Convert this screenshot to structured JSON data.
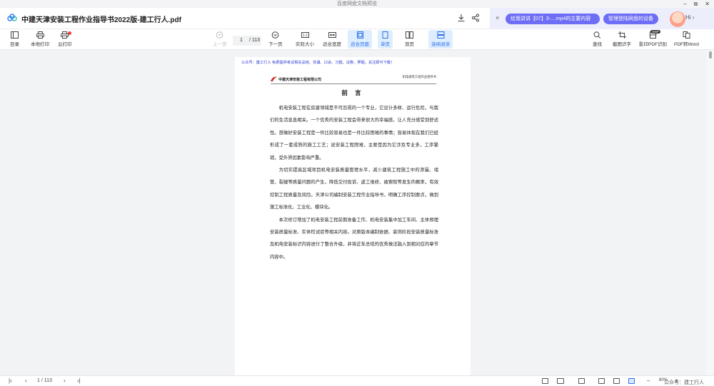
{
  "window": {
    "title": "百度网盘文档预览",
    "minimize": "–",
    "restore": "⧉",
    "close": "✕"
  },
  "header": {
    "doc_title": "中建天津安装工程作业指导书2022版-建工行人.pdf",
    "right_panel": {
      "close": "×",
      "pill_1": "给我讲讲【07】3-....mp4的主要内容",
      "pill_2": "管理登陆网盘的设备",
      "hi_label": "Hi ›"
    }
  },
  "toolbar": {
    "left": [
      {
        "label": "目录",
        "icon": "toc-icon"
      },
      {
        "label": "本地打印",
        "icon": "print-icon"
      },
      {
        "label": "云打印",
        "icon": "cloud-print-icon"
      }
    ],
    "prev_page": "上一页",
    "page_current": "1",
    "page_total": "/ 113",
    "next_page": "下一页",
    "actual_size": "实际大小",
    "fit_width": "适合宽度",
    "fit_page": "适合页面",
    "single_page": "单页",
    "double_page": "双页",
    "continuous": "连续阅读",
    "right": [
      {
        "label": "查找",
        "icon": "search-icon"
      },
      {
        "label": "截图识字",
        "icon": "screenshot-ocr-icon"
      },
      {
        "label": "影印PDF识别",
        "icon": "scan-pdf-icon"
      },
      {
        "label": "PDF转Word",
        "icon": "pdf-to-word-icon"
      }
    ],
    "new_badge": "SWP"
  },
  "document": {
    "promo_line": "公众号：建工行人  免费提供考试相关总结、背诵、口诀、习题、试卷、押题，关注即可下载！",
    "logo_text": "中建天津安装工程有限公司",
    "running_header": "机电安装工程作业指导书",
    "heading": "前 言",
    "paragraphs": [
      "机电安装工程在房建领域是不可忽视的一个专业，它设计多样、运行危险，与我们的生活息息相关。一个优秀的安装工程会带来很大的幸福感，让人充分感受到舒适性。想做好安装工程是一件比较容易也是一件比较困难的事情；容易体现在我们已经形成了一套成熟的施工工艺；说安装工程困难，主要是因为它涉及专业多，工序繁琐，受外界因素影响严重。",
      "为切实提高区域项目机电安装质量管理水平，减少建筑工程施工中的渗漏、堵管、裂缝等质量问题的产生，降低交付投诉、返工维修、被索赔等发生的概率，有效控制工程质量及风险。天津公司编制安装工程作业指导书，明确工序控制要点，做到施工标准化、工业化、模块化。",
      "本次修订增加了机电安装工程前期准备工作、机电安装集中加工车间、主体预埋安装质量标准、实体检试验等相关内容。对原版本编制依据、装饰阶段安装质量标准及机电安装标识内容进行了整合升级，并将近年总结的优秀做法融入到相对应的章节内容中。"
    ]
  },
  "statusbar": {
    "first": "|‹",
    "prev": "‹",
    "page_indicator": "1 / 113",
    "next": "›",
    "last": "›|",
    "zoom_out": "–",
    "zoom_value": "80%",
    "zoom_in": "+",
    "watermark": "公众号：建工行人"
  },
  "colors": {
    "accent": "#2c6fe8",
    "pill": "#6e6df5",
    "promo_text": "#2c3bd6",
    "logo_red": "#d7261e"
  }
}
